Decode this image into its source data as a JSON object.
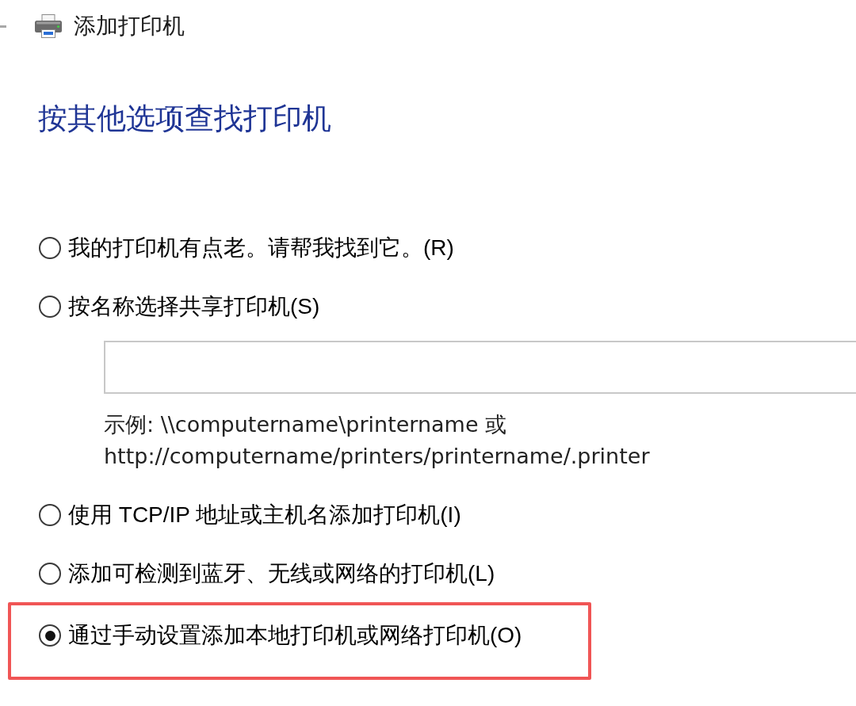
{
  "window": {
    "title": "添加打印机"
  },
  "heading": "按其他选项查找打印机",
  "options": [
    {
      "label": "我的打印机有点老。请帮我找到它。(R)",
      "selected": false,
      "highlighted": false
    },
    {
      "label": "按名称选择共享打印机(S)",
      "selected": false,
      "highlighted": false,
      "name_field": {
        "example": "示例: \\\\computername\\printername 或\nhttp://computername/printers/printername/.printer"
      }
    },
    {
      "label": "使用 TCP/IP 地址或主机名添加打印机(I)",
      "selected": false,
      "highlighted": false
    },
    {
      "label": "添加可检测到蓝牙、无线或网络的打印机(L)",
      "selected": false,
      "highlighted": false
    },
    {
      "label": "通过手动设置添加本地打印机或网络打印机(O)",
      "selected": true,
      "highlighted": true
    }
  ]
}
